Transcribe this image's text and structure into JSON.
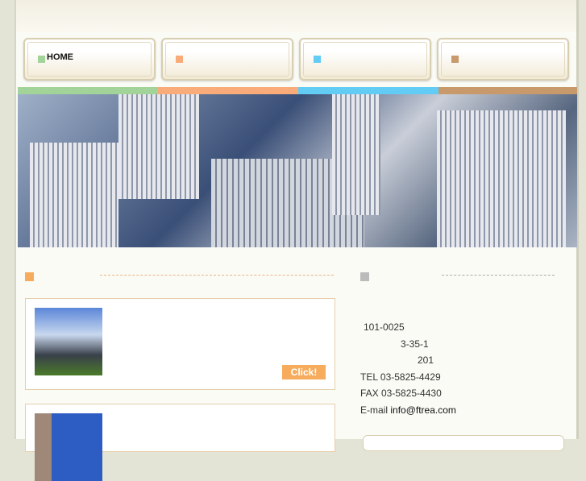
{
  "nav": {
    "items": [
      {
        "label": "HOME",
        "color": "#a2d49a"
      },
      {
        "label": "",
        "color": "#f9ab7a"
      },
      {
        "label": "",
        "color": "#62ccf4"
      },
      {
        "label": "",
        "color": "#c8996a"
      }
    ]
  },
  "colors": {
    "strip": [
      "#a2d49a",
      "#f9ab7a",
      "#62ccf4",
      "#c8996a"
    ],
    "news_accent": "#f7ab5c",
    "info_accent": "#bbbbbb"
  },
  "news": {
    "cards": [
      {
        "button": "Click!"
      },
      {
        "button": ""
      }
    ]
  },
  "company": {
    "postal": "101-0025",
    "address1": "3-35-1",
    "address2": "201",
    "tel": "TEL 03-5825-4429",
    "fax": "FAX 03-5825-4430",
    "email_label": "E-mail",
    "email": "info@ftrea.com"
  }
}
